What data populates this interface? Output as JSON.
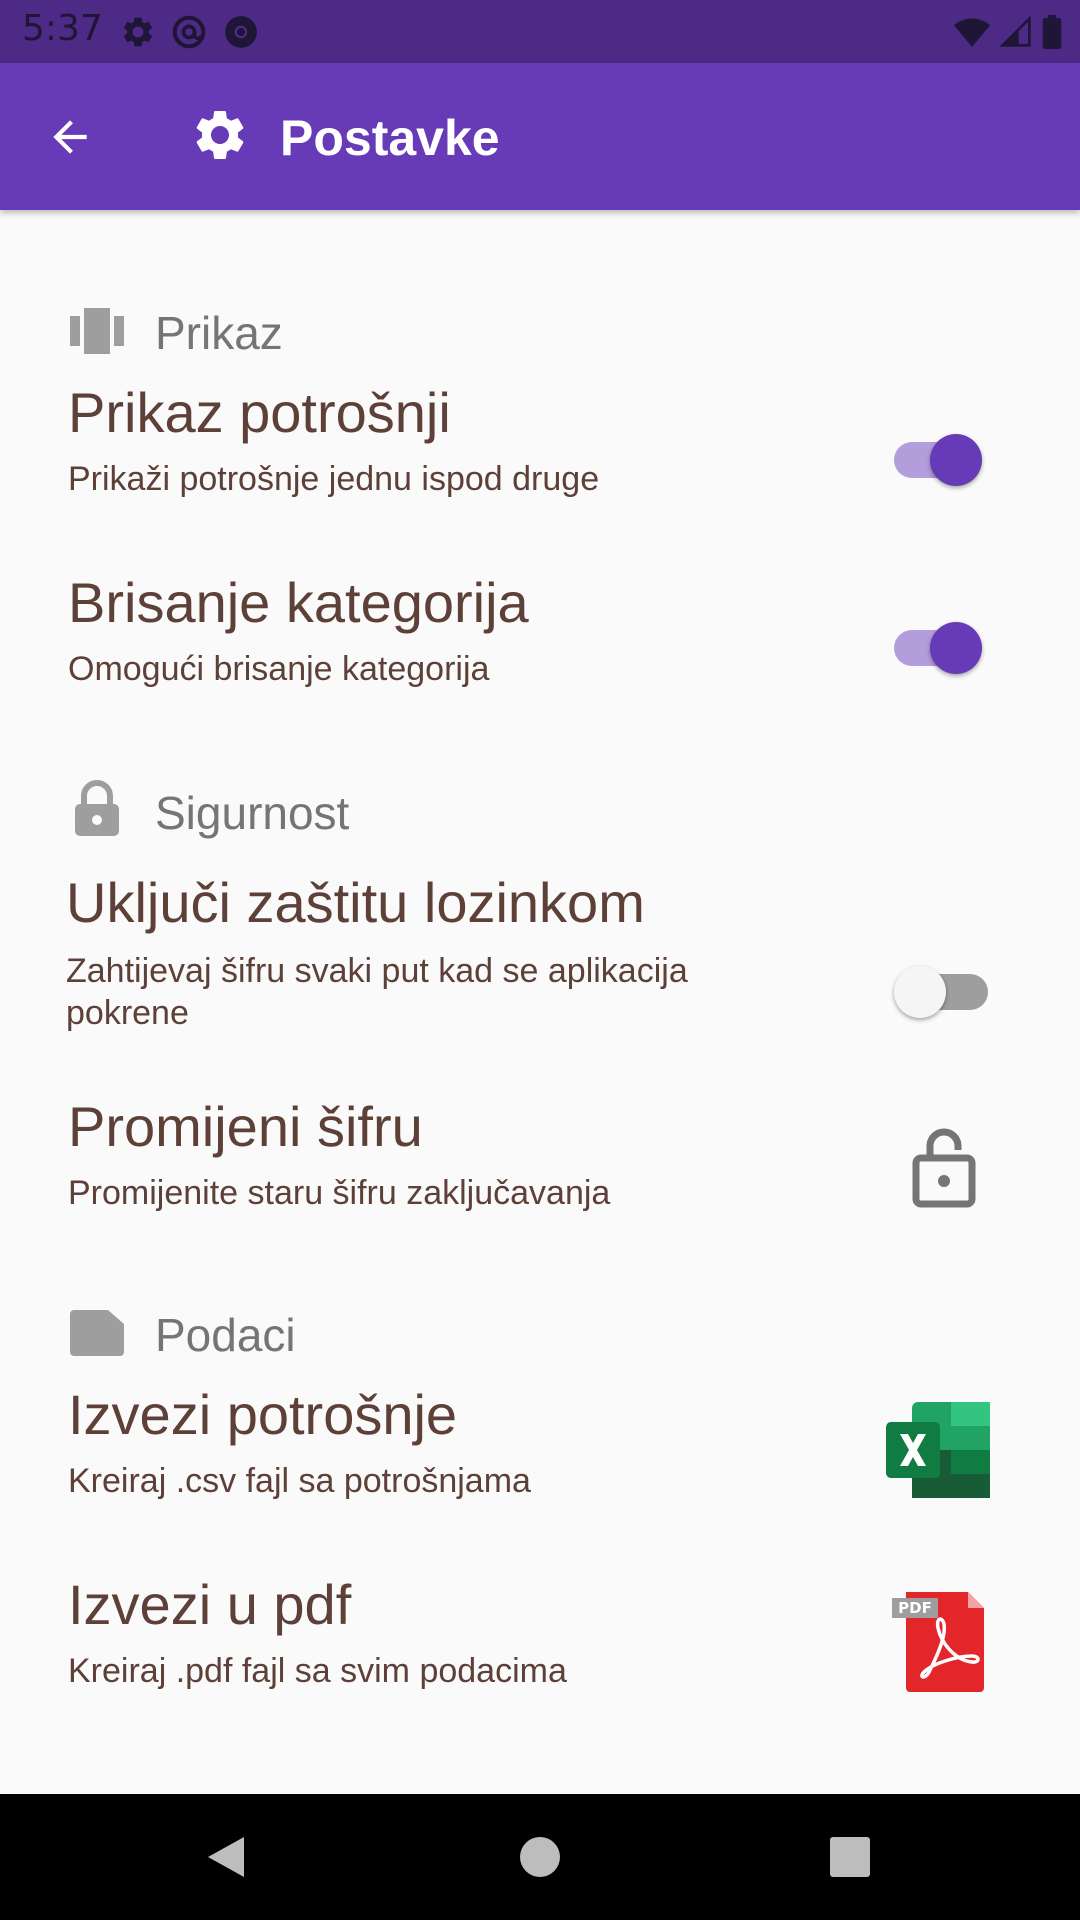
{
  "status_bar": {
    "time": "5:37"
  },
  "app_bar": {
    "title": "Postavke"
  },
  "categories": [
    {
      "title": "Prikaz",
      "items": [
        {
          "title": "Prikaz potrošnji",
          "summary": "Prikaži potrošnje jednu ispod druge",
          "checked": true
        },
        {
          "title": "Brisanje kategorija",
          "summary": "Omogući brisanje kategorija",
          "checked": true
        }
      ]
    },
    {
      "title": "Sigurnost",
      "items": [
        {
          "title": "Uključi zaštitu lozinkom",
          "summary": "Zahtijevaj šifru svaki put kad se aplikacija pokrene",
          "checked": false
        },
        {
          "title": "Promijeni šifru",
          "summary": "Promijenite staru šifru zaključavanja",
          "icon": "lock-open-icon"
        }
      ]
    },
    {
      "title": "Podaci",
      "items": [
        {
          "title": "Izvezi potrošnje",
          "summary": "Kreiraj .csv fajl sa potrošnjama",
          "icon": "excel-icon"
        },
        {
          "title": "Izvezi u pdf",
          "summary": "Kreiraj .pdf fajl sa svim podacima",
          "icon": "pdf-icon",
          "icon_badge": "PDF"
        }
      ]
    }
  ],
  "colors": {
    "primary": "#673AB7",
    "status_bar": "#4E2A87",
    "switch_track_on": "#B39DDB",
    "text_brown": "#5D4037",
    "category_gray": "#757575"
  }
}
